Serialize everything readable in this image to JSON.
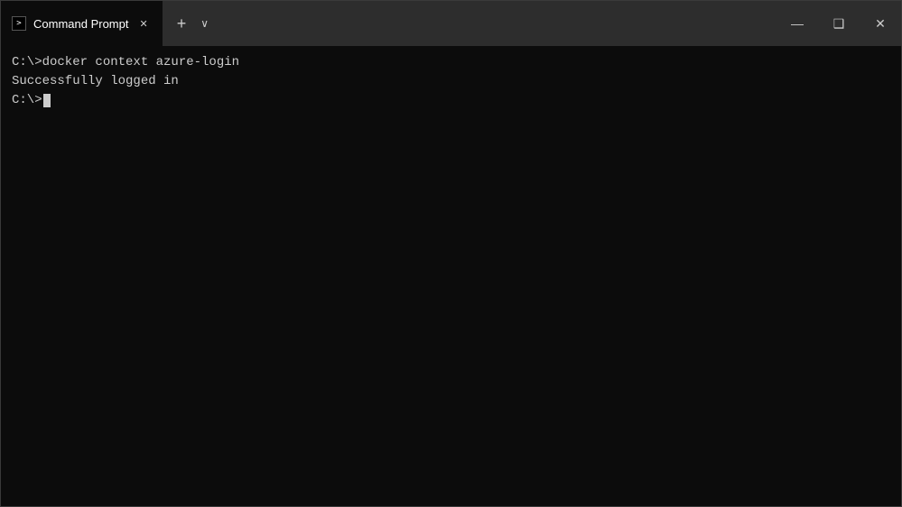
{
  "titleBar": {
    "tabTitle": "Command Prompt",
    "newTabLabel": "+",
    "dropdownLabel": "∨",
    "minimizeLabel": "—",
    "maximizeLabel": "❑",
    "closeLabel": "✕"
  },
  "terminal": {
    "line1": "C:\\>docker context azure-login",
    "line2": "Successfully logged in",
    "line3": "",
    "prompt": "C:\\>"
  }
}
